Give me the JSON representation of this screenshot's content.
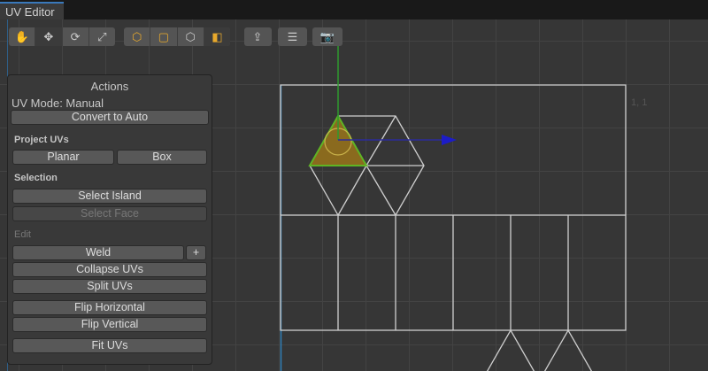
{
  "window": {
    "title": "UV Editor"
  },
  "toolbar": {
    "tools": [
      "hand-icon",
      "move-icon",
      "rotate-icon",
      "scale-icon"
    ],
    "select_modes": [
      "vertex-select-icon",
      "edge-select-icon",
      "face-select-icon",
      "object-select-icon"
    ],
    "extras": [
      "export-icon",
      "texture-settings-icon",
      "screenshot-icon"
    ]
  },
  "canvas": {
    "coord_label": "1, 1",
    "selection_color": "#8a6a1e",
    "selection_outline": "#5fb424"
  },
  "panel": {
    "title": "Actions",
    "uv_mode": "UV Mode: Manual",
    "convert": "Convert to Auto",
    "project_header": "Project UVs",
    "planar": "Planar",
    "box": "Box",
    "selection_header": "Selection",
    "select_island": "Select Island",
    "select_face": "Select Face",
    "edit_header": "Edit",
    "weld": "Weld",
    "weld_plus": "+",
    "collapse": "Collapse UVs",
    "split": "Split UVs",
    "flip_h": "Flip Horizontal",
    "flip_v": "Flip Vertical",
    "fit": "Fit UVs"
  }
}
